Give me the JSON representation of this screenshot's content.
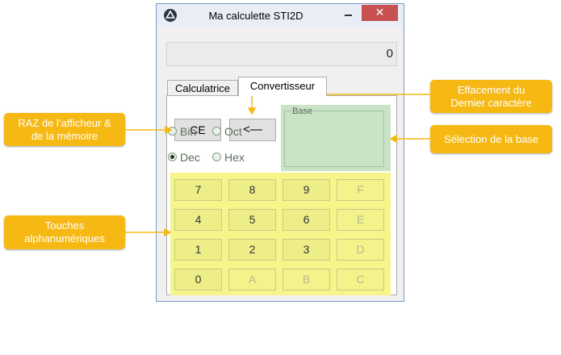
{
  "window": {
    "title": "Ma calculette STI2D",
    "close_glyph": "✕",
    "app_icon": "app-logo-icon"
  },
  "display": {
    "value": "0"
  },
  "tabs": [
    {
      "label": "Calculatrice",
      "active": false
    },
    {
      "label": "Convertisseur",
      "active": true
    }
  ],
  "buttons": {
    "ce": "CE",
    "backspace": "<—"
  },
  "base": {
    "legend": "Base",
    "options": [
      {
        "label": "Bin",
        "selected": false
      },
      {
        "label": "Oct",
        "selected": false
      },
      {
        "label": "Dec",
        "selected": true
      },
      {
        "label": "Hex",
        "selected": false
      }
    ]
  },
  "keypad": [
    [
      "7",
      "8",
      "9",
      "F"
    ],
    [
      "4",
      "5",
      "6",
      "E"
    ],
    [
      "1",
      "2",
      "3",
      "D"
    ],
    [
      "0",
      "A",
      "B",
      "C"
    ]
  ],
  "annotations": {
    "raz": [
      "RAZ de l’afficheur &",
      "de la mémoire"
    ],
    "effacement": [
      "Effacement du",
      "Dernier caractère"
    ],
    "selection": [
      "Sélection de la base"
    ],
    "touches": [
      "Touches",
      "alphanumériques"
    ]
  },
  "colors": {
    "callout": "#f6b914",
    "keypad_highlight": "#f5f58a",
    "base_highlight": "#c8e3c6",
    "close_button": "#c75050"
  }
}
